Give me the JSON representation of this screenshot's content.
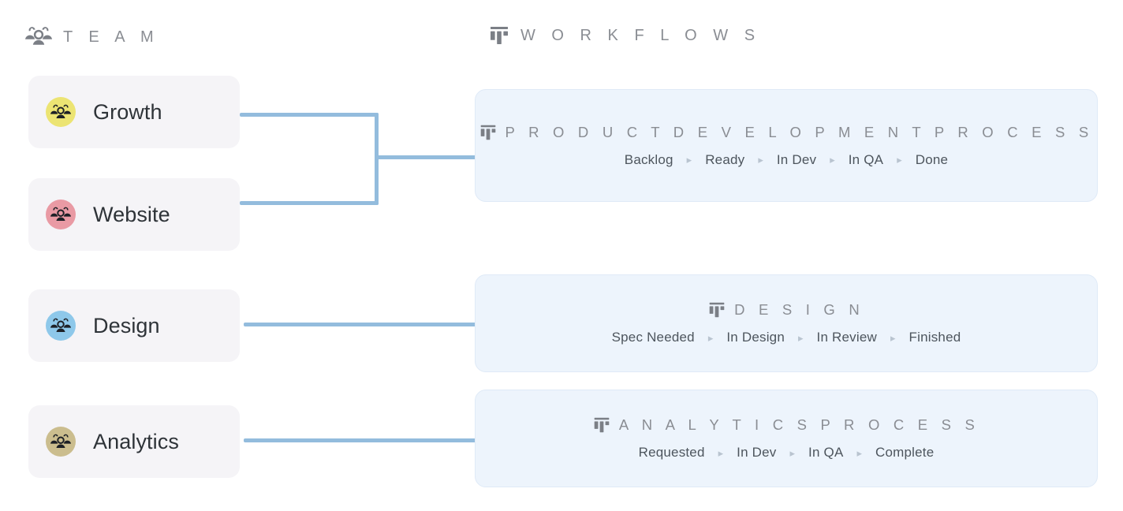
{
  "columns": {
    "team": {
      "label": "T E A M",
      "icon": "people-icon"
    },
    "workflows": {
      "label": "W O R K F L O W S",
      "icon": "board-icon"
    }
  },
  "teams": [
    {
      "name": "Growth",
      "color": "#ece473",
      "icon": "people-icon"
    },
    {
      "name": "Website",
      "color": "#e99aa4",
      "icon": "people-icon"
    },
    {
      "name": "Design",
      "color": "#8ec8ea",
      "icon": "people-icon"
    },
    {
      "name": "Analytics",
      "color": "#cbbd8e",
      "icon": "people-icon"
    }
  ],
  "workflows": [
    {
      "title": "P R O D U C T   D E V E L O P M E N T   P R O C E S S",
      "icon": "board-icon",
      "stages": [
        "Backlog",
        "Ready",
        "In Dev",
        "In QA",
        "Done"
      ]
    },
    {
      "title": "D E S I G N",
      "icon": "board-icon",
      "stages": [
        "Spec Needed",
        "In Design",
        "In Review",
        "Finished"
      ]
    },
    {
      "title": "A N A L Y T I C S   P R O C E S S",
      "icon": "board-icon",
      "stages": [
        "Requested",
        "In Dev",
        "In QA",
        "Complete"
      ]
    }
  ],
  "arrow_glyph": "▸",
  "colors": {
    "connector": "#93bcdd",
    "team_card_bg": "#f5f4f7",
    "workflow_card_bg": "#edf4fc",
    "workflow_card_border": "#dfeaf7",
    "heading_text": "#8a8d93",
    "team_text": "#2e3338",
    "stage_text": "#4d555d",
    "arrow": "#b9c4d0"
  }
}
